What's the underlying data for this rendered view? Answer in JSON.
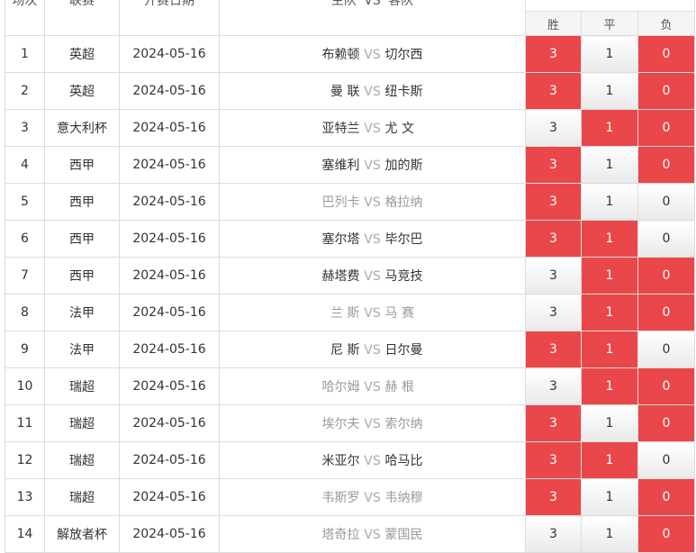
{
  "header": {
    "col_no": "场次",
    "col_league": "联赛",
    "col_date": "开赛日期",
    "col_home": "主队",
    "col_vs": "VS",
    "col_away": "客队",
    "col_win": "胜",
    "col_draw": "平",
    "col_lose": "负"
  },
  "colors": {
    "selected": "#e9474a",
    "inactive_team": "#999999"
  },
  "rows": [
    {
      "no": "1",
      "league": "英超",
      "date": "2024-05-16",
      "home": "布赖顿",
      "vs": "VS",
      "away": "切尔西",
      "home_gray": false,
      "away_gray": false,
      "win": "3",
      "draw": "1",
      "lose": "0",
      "sel": [
        true,
        false,
        true
      ]
    },
    {
      "no": "2",
      "league": "英超",
      "date": "2024-05-16",
      "home": "曼 联",
      "vs": "VS",
      "away": "纽卡斯",
      "home_gray": false,
      "away_gray": false,
      "win": "3",
      "draw": "1",
      "lose": "0",
      "sel": [
        true,
        false,
        true
      ]
    },
    {
      "no": "3",
      "league": "意大利杯",
      "date": "2024-05-16",
      "home": "亚特兰",
      "vs": "VS",
      "away": "尤 文",
      "home_gray": false,
      "away_gray": false,
      "win": "3",
      "draw": "1",
      "lose": "0",
      "sel": [
        false,
        true,
        true
      ]
    },
    {
      "no": "4",
      "league": "西甲",
      "date": "2024-05-16",
      "home": "塞维利",
      "vs": "VS",
      "away": "加的斯",
      "home_gray": false,
      "away_gray": false,
      "win": "3",
      "draw": "1",
      "lose": "0",
      "sel": [
        true,
        false,
        true
      ]
    },
    {
      "no": "5",
      "league": "西甲",
      "date": "2024-05-16",
      "home": "巴列卡",
      "vs": "VS",
      "away": "格拉纳",
      "home_gray": true,
      "away_gray": true,
      "win": "3",
      "draw": "1",
      "lose": "0",
      "sel": [
        true,
        false,
        false
      ]
    },
    {
      "no": "6",
      "league": "西甲",
      "date": "2024-05-16",
      "home": "塞尔塔",
      "vs": "VS",
      "away": "毕尔巴",
      "home_gray": false,
      "away_gray": false,
      "win": "3",
      "draw": "1",
      "lose": "0",
      "sel": [
        true,
        true,
        false
      ]
    },
    {
      "no": "7",
      "league": "西甲",
      "date": "2024-05-16",
      "home": "赫塔费",
      "vs": "VS",
      "away": "马竞技",
      "home_gray": false,
      "away_gray": false,
      "win": "3",
      "draw": "1",
      "lose": "0",
      "sel": [
        false,
        true,
        true
      ]
    },
    {
      "no": "8",
      "league": "法甲",
      "date": "2024-05-16",
      "home": "兰 斯",
      "vs": "VS",
      "away": "马 赛",
      "home_gray": true,
      "away_gray": true,
      "win": "3",
      "draw": "1",
      "lose": "0",
      "sel": [
        false,
        true,
        true
      ]
    },
    {
      "no": "9",
      "league": "法甲",
      "date": "2024-05-16",
      "home": "尼 斯",
      "vs": "VS",
      "away": "日尔曼",
      "home_gray": false,
      "away_gray": false,
      "win": "3",
      "draw": "1",
      "lose": "0",
      "sel": [
        true,
        true,
        false
      ]
    },
    {
      "no": "10",
      "league": "瑞超",
      "date": "2024-05-16",
      "home": "哈尔姆",
      "vs": "VS",
      "away": "赫 根",
      "home_gray": true,
      "away_gray": true,
      "win": "3",
      "draw": "1",
      "lose": "0",
      "sel": [
        false,
        true,
        true
      ]
    },
    {
      "no": "11",
      "league": "瑞超",
      "date": "2024-05-16",
      "home": "埃尔夫",
      "vs": "VS",
      "away": "索尔纳",
      "home_gray": true,
      "away_gray": true,
      "win": "3",
      "draw": "1",
      "lose": "0",
      "sel": [
        true,
        false,
        true
      ]
    },
    {
      "no": "12",
      "league": "瑞超",
      "date": "2024-05-16",
      "home": "米亚尔",
      "vs": "VS",
      "away": "哈马比",
      "home_gray": false,
      "away_gray": false,
      "win": "3",
      "draw": "1",
      "lose": "0",
      "sel": [
        true,
        true,
        false
      ]
    },
    {
      "no": "13",
      "league": "瑞超",
      "date": "2024-05-16",
      "home": "韦斯罗",
      "vs": "VS",
      "away": "韦纳穆",
      "home_gray": true,
      "away_gray": true,
      "win": "3",
      "draw": "1",
      "lose": "0",
      "sel": [
        true,
        false,
        true
      ]
    },
    {
      "no": "14",
      "league": "解放者杯",
      "date": "2024-05-16",
      "home": "塔奇拉",
      "vs": "VS",
      "away": "蒙国民",
      "home_gray": true,
      "away_gray": true,
      "win": "3",
      "draw": "1",
      "lose": "0",
      "sel": [
        false,
        false,
        true
      ]
    }
  ]
}
